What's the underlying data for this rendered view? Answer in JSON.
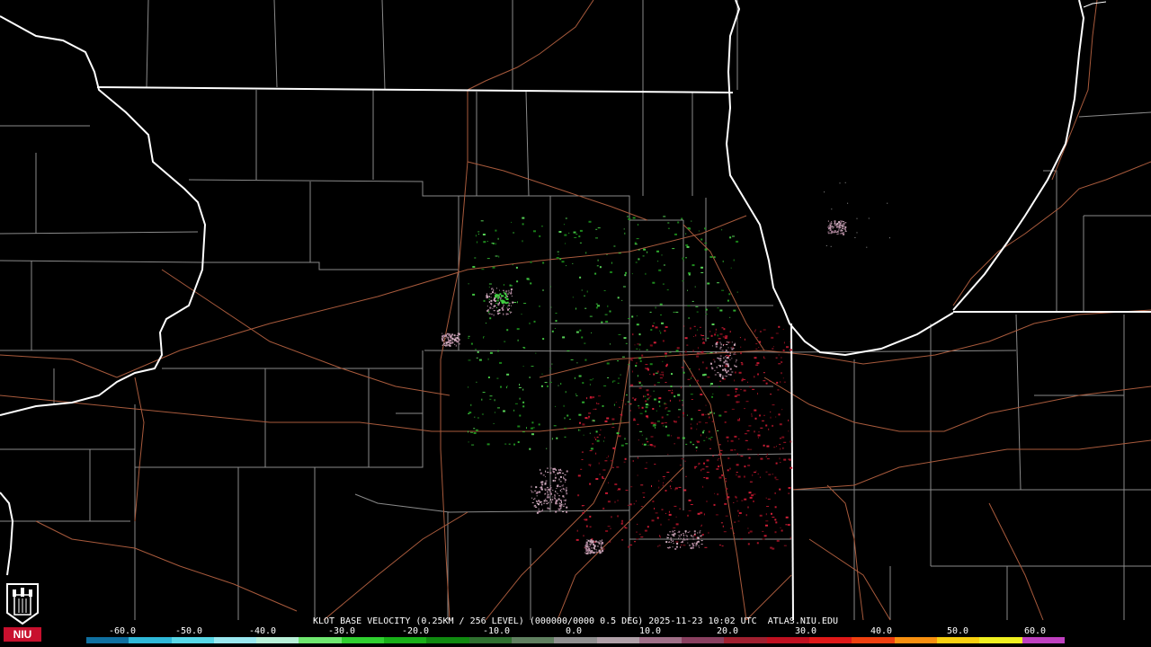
{
  "caption": "KLOT BASE VELOCITY (0.25KM / 256 LEVEL) (000000/0000 0.5 DEG) 2025-11-23 10:02 UTC  ATLAS.NIU.EDU",
  "logo": {
    "text": "NIU",
    "icon": "niu-logo-icon"
  },
  "scale": {
    "labels": [
      "-60.0",
      "-50.0",
      "-40.0",
      "-30.0",
      "-20.0",
      "-10.0",
      "0.0",
      "10.0",
      "20.0",
      "30.0",
      "40.0",
      "50.0",
      "60.0"
    ],
    "colors": [
      "#1070a0",
      "#2fb8d8",
      "#58d8e8",
      "#9ae8f0",
      "#b8f0d8",
      "#70e870",
      "#30d030",
      "#18b018",
      "#108a10",
      "#307030",
      "#608060",
      "#909090",
      "#b0a0a8",
      "#a07088",
      "#8a4060",
      "#a02030",
      "#c01020",
      "#e01818",
      "#f04010",
      "#f89010",
      "#f8d010",
      "#f0f020",
      "#c040c0"
    ]
  },
  "colors": {
    "state_border": "#ffffff",
    "county_border": "#8a8a8a",
    "roads": "#a85a3c",
    "inbound": "#2ea82e",
    "outbound": "#c01830",
    "nearzero": "#b48ca0"
  }
}
